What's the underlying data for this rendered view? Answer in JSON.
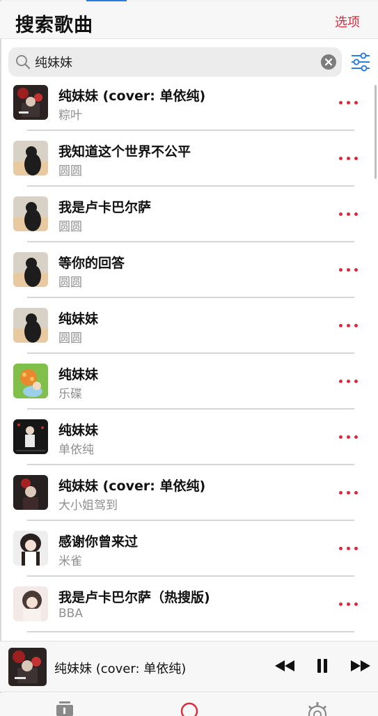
{
  "header": {
    "title": "搜索歌曲",
    "options_label": "选项"
  },
  "search": {
    "value": "纯妹妹",
    "placeholder": ""
  },
  "results": [
    {
      "title": "纯妹妹 (cover: 单依纯)",
      "artist": "粽叶",
      "thumb": "dark-red-poster"
    },
    {
      "title": "我知道这个世界不公平",
      "artist": "圆圆",
      "thumb": "silhouette-sunset"
    },
    {
      "title": "我是卢卡巴尔萨",
      "artist": "圆圆",
      "thumb": "silhouette-sunset"
    },
    {
      "title": "等你的回答",
      "artist": "圆圆",
      "thumb": "silhouette-sunset"
    },
    {
      "title": "纯妹妹",
      "artist": "圆圆",
      "thumb": "silhouette-sunset"
    },
    {
      "title": "纯妹妹",
      "artist": "乐碟",
      "thumb": "cartoon-green"
    },
    {
      "title": "纯妹妹",
      "artist": "单依纯",
      "thumb": "dark-portrait"
    },
    {
      "title": "纯妹妹 (cover: 单依纯)",
      "artist": "大小姐驾到",
      "thumb": "dark-red-girl"
    },
    {
      "title": "感谢你曾来过",
      "artist": "米雀",
      "thumb": "girl-portrait"
    },
    {
      "title": "我是卢卡巴尔萨（热搜版)",
      "artist": "BBA",
      "thumb": "girl-soft"
    }
  ],
  "now_playing": {
    "title": "纯妹妹 (cover: 单依纯)",
    "thumb": "dark-red-poster"
  },
  "colors": {
    "accent": "#e0283a",
    "blue": "#2a7de1",
    "secondary_text": "#8f8f8f"
  },
  "icons": [
    "search-icon",
    "clear-icon",
    "filter-icon",
    "more-icon",
    "rewind-icon",
    "pause-icon",
    "forward-icon",
    "library-tab-icon",
    "search-tab-icon",
    "settings-tab-icon"
  ]
}
